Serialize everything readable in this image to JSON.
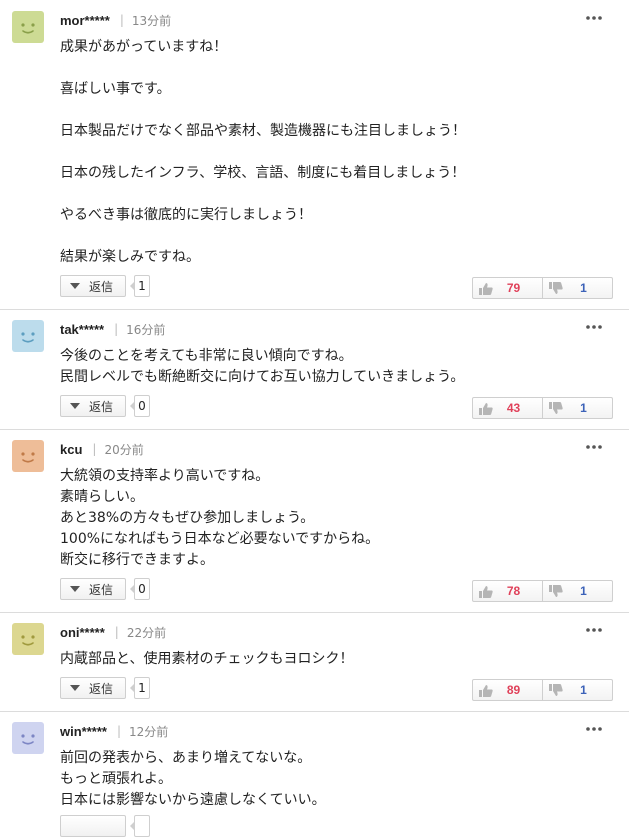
{
  "comments": [
    {
      "username": "mor*****",
      "time": "13分前",
      "avatar_color": "#cddb94",
      "lines": [
        "成果があがっていますね！",
        "",
        "喜ばしい事です。",
        "",
        "日本製品だけでなく部品や素材、製造機器にも注目しましょう！",
        "",
        "日本の残したインフラ、学校、言語、制度にも着目しましょう！",
        "",
        "やるべき事は徹底的に実行しましょう！",
        "",
        "結果が楽しみですね。"
      ],
      "reply_label": "返信",
      "reply_count": "1",
      "good": "79",
      "bad": "1"
    },
    {
      "username": "tak*****",
      "time": "16分前",
      "avatar_color": "#bcdcec",
      "lines": [
        "今後のことを考えても非常に良い傾向ですね。",
        "民間レベルでも断絶断交に向けてお互い協力していきましょう。"
      ],
      "reply_label": "返信",
      "reply_count": "0",
      "good": "43",
      "bad": "1"
    },
    {
      "username": "kcu",
      "time": "20分前",
      "avatar_color": "#eebd98",
      "lines": [
        "大統領の支持率より高いですね。",
        "素晴らしい。",
        "あと38%の方々もぜひ参加しましょう。",
        "100%になればもう日本など必要ないですからね。",
        "断交に移行できますよ。"
      ],
      "reply_label": "返信",
      "reply_count": "0",
      "good": "78",
      "bad": "1"
    },
    {
      "username": "oni*****",
      "time": "22分前",
      "avatar_color": "#dcd790",
      "lines": [
        "内蔵部品と、使用素材のチェックもヨロシク！"
      ],
      "reply_label": "返信",
      "reply_count": "1",
      "good": "89",
      "bad": "1"
    },
    {
      "username": "win*****",
      "time": "12分前",
      "avatar_color": "#cfd4f0",
      "lines": [
        "前回の発表から、あまり増えてないな。",
        "もっと頑張れよ。",
        "日本には影響ないから遠慮しなくていい。"
      ],
      "reply_label": "",
      "reply_count": "",
      "good": "",
      "bad": ""
    }
  ],
  "icons": {
    "more": "more-options-icon",
    "good": "thumbs-up-icon",
    "bad": "thumbs-down-icon",
    "reply": "triangle-down-icon"
  }
}
